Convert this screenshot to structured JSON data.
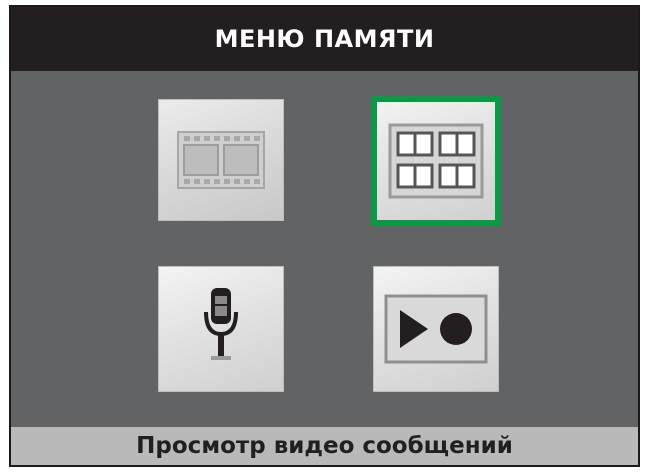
{
  "header": {
    "title": "МЕНЮ ПАМЯТИ"
  },
  "footer": {
    "status": "Просмотр видео сообщений"
  },
  "menu": {
    "items": [
      {
        "icon": "film-strip-icon",
        "selected": false
      },
      {
        "icon": "grid-gallery-icon",
        "selected": true
      },
      {
        "icon": "microphone-icon",
        "selected": false
      },
      {
        "icon": "play-record-icon",
        "selected": false
      }
    ]
  },
  "colors": {
    "background": "#616364",
    "header": "#231f20",
    "footer": "#b9b9b9",
    "selection": "#0a9a46"
  }
}
